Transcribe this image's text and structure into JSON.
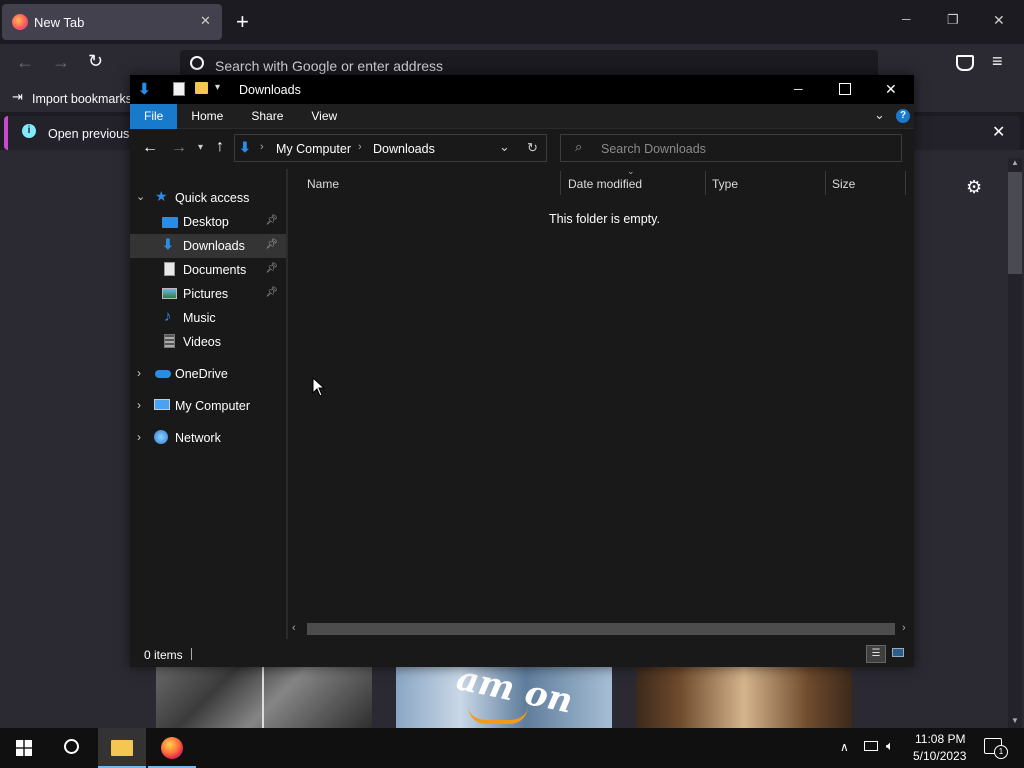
{
  "browser": {
    "tab_title": "New Tab",
    "new_tab_icon": "+",
    "url_placeholder": "Search with Google or enter address",
    "bookmarks_label": "Import bookmarks",
    "infobar_text": "Open previous t",
    "window_controls": {
      "minimize": "─",
      "restore": "❐",
      "close": "✕"
    }
  },
  "explorer": {
    "window_title": "Downloads",
    "ribbon_tabs": [
      "File",
      "Home",
      "Share",
      "View"
    ],
    "breadcrumb": [
      "My Computer",
      "Downloads"
    ],
    "search_placeholder": "Search Downloads",
    "columns": [
      "Name",
      "Date modified",
      "Type",
      "Size"
    ],
    "empty_text": "This folder is empty.",
    "status": "0 items",
    "nav": {
      "quick_access": "Quick access",
      "items": [
        {
          "label": "Desktop",
          "icon": "desktop-icon",
          "pinned": true
        },
        {
          "label": "Downloads",
          "icon": "downloads-icon",
          "pinned": true,
          "selected": true
        },
        {
          "label": "Documents",
          "icon": "documents-icon",
          "pinned": true
        },
        {
          "label": "Pictures",
          "icon": "pictures-icon",
          "pinned": true
        },
        {
          "label": "Music",
          "icon": "music-icon",
          "pinned": false
        },
        {
          "label": "Videos",
          "icon": "videos-icon",
          "pinned": false
        }
      ],
      "roots": [
        {
          "label": "OneDrive",
          "icon": "onedrive-icon"
        },
        {
          "label": "My Computer",
          "icon": "computer-icon"
        },
        {
          "label": "Network",
          "icon": "network-icon"
        }
      ]
    }
  },
  "taskbar": {
    "time": "11:08 PM",
    "date": "5/10/2023",
    "notification_count": "1"
  },
  "colors": {
    "accent": "#0078d7",
    "file_tab": "#1979ca",
    "browser_accent": "#c74bd1"
  }
}
